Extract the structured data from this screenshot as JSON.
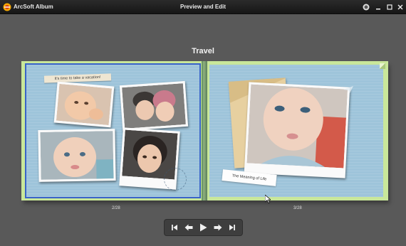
{
  "window": {
    "app_name": "ArcSoft Album",
    "title": "Preview and Edit",
    "controls": [
      "help-icon",
      "minimize-icon",
      "maximize-icon",
      "close-icon"
    ]
  },
  "album": {
    "title": "Travel",
    "left_page": {
      "number": "2/28",
      "note_text": "It's time to take a vacation!",
      "photos": [
        "baby-photo",
        "couple-kids-photo",
        "toddler-photo",
        "boy-photo"
      ]
    },
    "right_page": {
      "number": "3/28",
      "tag_text": "The Meaning of Life",
      "photos": [
        "baby-closeup-photo"
      ]
    }
  },
  "navigation": {
    "buttons": [
      "first-page",
      "previous-page",
      "play",
      "next-page",
      "last-page"
    ]
  },
  "colors": {
    "background": "#595959",
    "page_border": "#c9e79a",
    "page_fill": "#9ec4da",
    "selection": "#3a64c8"
  }
}
